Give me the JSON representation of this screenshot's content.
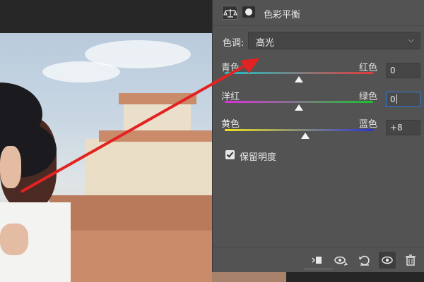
{
  "panel": {
    "title": "色彩平衡",
    "tone_label": "色调:",
    "tone_value": "高光",
    "sliders": [
      {
        "left": "青色",
        "right": "红色",
        "value": "0",
        "gradient": [
          "#19c3c8",
          "#e23a3a"
        ]
      },
      {
        "left": "洋红",
        "right": "绿色",
        "value": "0",
        "gradient": [
          "#e02ee0",
          "#19c32a"
        ]
      },
      {
        "left": "黄色",
        "right": "蓝色",
        "value": "+8",
        "gradient": [
          "#f1e31c",
          "#2636d6"
        ]
      }
    ],
    "preserve_luminosity": {
      "label": "保留明度",
      "checked": true
    },
    "footer_icons": [
      "clip-to-layer-icon",
      "view-previous-icon",
      "reset-icon",
      "visibility-eye-icon",
      "trash-icon"
    ]
  },
  "colors": {
    "panel_bg": "#535353",
    "annotation_arrow": "#e32222",
    "focus": "#2e7bd6"
  }
}
